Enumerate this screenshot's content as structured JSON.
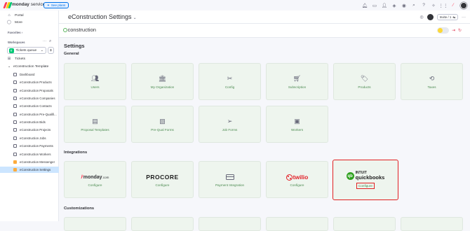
{
  "topbar": {
    "brand": "monday",
    "brand_suffix": "service",
    "see_plans": "See plans"
  },
  "sidebar": {
    "nav": [
      {
        "label": "Portal",
        "icon": "portal-icon"
      },
      {
        "label": "More",
        "icon": "more-icon"
      }
    ],
    "favorites_label": "Favorites",
    "workspaces_label": "Workspaces",
    "workspace": {
      "badge": "T",
      "name": "Tickets queue"
    },
    "tickets_label": "Tickets",
    "folder": "eConstruction Template",
    "items": [
      "Dashboard",
      "eConstruction Products",
      "eConstruction Proposals",
      "eConstruction Companies",
      "eConstruction Contacts",
      "eConstruction Pre-Qualifi...",
      "eConstruction Bids",
      "eConstruction Projects",
      "eConstruction Jobs",
      "eConstruction Payments",
      "eConstruction Workers",
      "eConstruction Messenger",
      "eConstruction Settings"
    ]
  },
  "board": {
    "title": "eConstruction Settings",
    "invite": "Invite / 1"
  },
  "app": {
    "logo_text": "construction"
  },
  "settings": {
    "heading": "Settings",
    "general_heading": "General",
    "general": [
      {
        "label": "Users",
        "icon": "users-icon"
      },
      {
        "label": "My Organization",
        "icon": "organization-icon"
      },
      {
        "label": "Config",
        "icon": "config-icon"
      },
      {
        "label": "Subscription",
        "icon": "cart-icon"
      },
      {
        "label": "Products",
        "icon": "tag-icon"
      },
      {
        "label": "Taxes",
        "icon": "taxes-icon"
      },
      {
        "label": "Proposal Templates",
        "icon": "document-icon"
      },
      {
        "label": "Pre-Qual Forms",
        "icon": "form-icon"
      },
      {
        "label": "Job Forms",
        "icon": "send-icon"
      },
      {
        "label": "Workers",
        "icon": "worker-icon"
      }
    ],
    "integrations_heading": "Integrations",
    "integrations": [
      {
        "brand": "monday",
        "brand_suffix": ".com",
        "label": "Configure"
      },
      {
        "brand": "PROCORE",
        "label": "Configure"
      },
      {
        "brand": "",
        "label": "Payment Integration"
      },
      {
        "brand": "twilio",
        "label": "Configure"
      },
      {
        "brand_top": "INTUIT",
        "brand": "quickbooks",
        "label": "Configure"
      }
    ],
    "customizations_heading": "Customizations"
  }
}
